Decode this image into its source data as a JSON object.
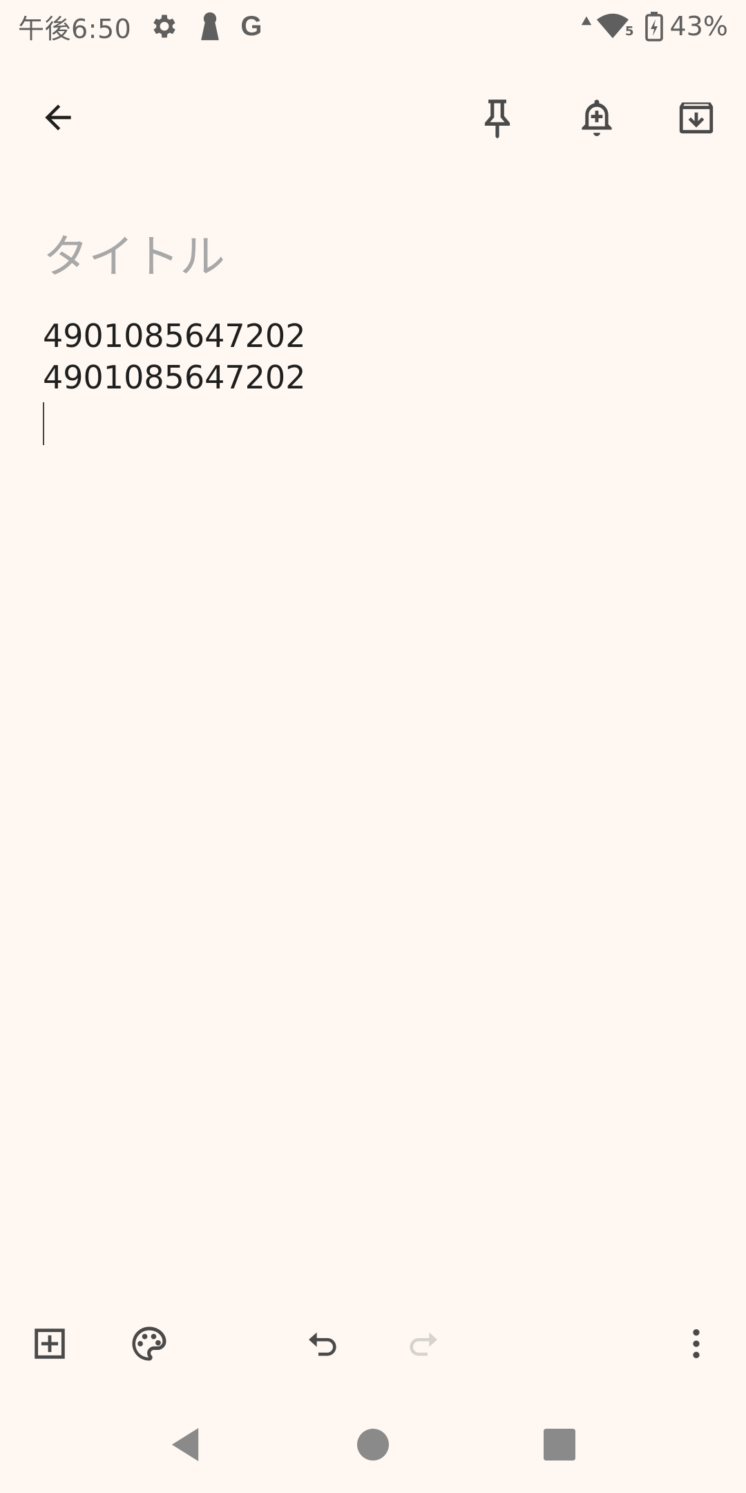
{
  "status_bar": {
    "time": "午後6:50",
    "battery_percent": "43%",
    "g_label": "G",
    "icons": [
      "settings-gear-icon",
      "keyhole-icon",
      "google-icon",
      "signal-arrow-icon",
      "wifi-icon",
      "battery-charging-icon"
    ],
    "wifi_badge": "5"
  },
  "top_bar": {
    "icons": [
      "back-arrow-icon",
      "pin-icon",
      "add-reminder-icon",
      "archive-icon"
    ]
  },
  "note": {
    "title_placeholder": "タイトル",
    "lines": [
      "4901085647202",
      "4901085647202"
    ]
  },
  "bottom_toolbar": {
    "icons": [
      "add-box-icon",
      "palette-icon",
      "undo-icon",
      "redo-icon",
      "more-vert-icon"
    ],
    "redo_enabled": false
  },
  "nav_bar": {
    "icons": [
      "nav-back-icon",
      "nav-home-icon",
      "nav-recents-icon"
    ]
  },
  "colors": {
    "background": "#fff8f2",
    "icon": "#4a4a4a",
    "placeholder": "#a8a8a8",
    "text": "#1f1f1f",
    "disabled": "#d6d3cf",
    "nav": "#8a8a8a"
  }
}
